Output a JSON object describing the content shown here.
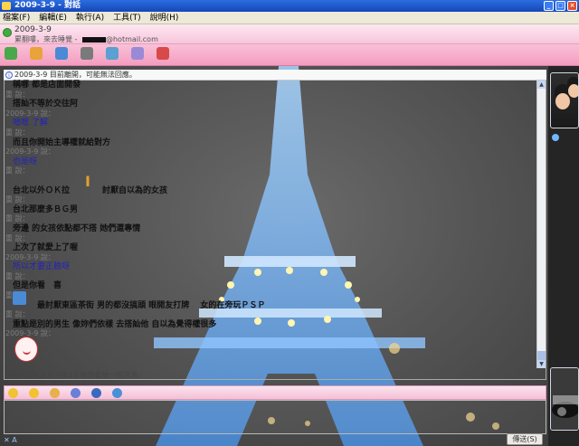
{
  "window": {
    "title": "2009-3-9 - 對話"
  },
  "menu": [
    "檔案(F)",
    "編輯(E)",
    "執行(A)",
    "工具(T)",
    "說明(H)"
  ],
  "contact": {
    "name": "2009-3-9",
    "message": "累翻嘍，來去睡覺 -",
    "email_suffix": "@hotmail.com"
  },
  "notice": "2009-3-9 目前離開，可能無法回應。",
  "messages": [
    {
      "text": "稱哪 都是店面開發",
      "style": "msg"
    },
    {
      "text": "重 說：",
      "style": "sys"
    },
    {
      "text": "搭訕不等於交往阿",
      "style": "msg"
    },
    {
      "text": "2009-3-9 說：",
      "style": "sys"
    },
    {
      "text": "嗯嗯 了解",
      "style": "blue"
    },
    {
      "text": "重 說：",
      "style": "sys"
    },
    {
      "text": "而且你開始主導權就給對方",
      "style": "msg"
    },
    {
      "text": "2009-3-9 說：",
      "style": "sys"
    },
    {
      "text": "也是呀",
      "style": "blue"
    },
    {
      "text": "重 說：",
      "style": "sys"
    },
    {
      "text": "",
      "style": "msg"
    },
    {
      "text": "台北以外ＯＫ拉　　　　討厭自以為的女孩",
      "style": "msg"
    },
    {
      "text": "重 說：",
      "style": "sys"
    },
    {
      "text": "台北那麼多ＢＧ男",
      "style": "msg"
    },
    {
      "text": "重 說：",
      "style": "sys"
    },
    {
      "text": "旁邊 的女孩依點都不搭 她們還專情",
      "style": "msg"
    },
    {
      "text": "重 說：",
      "style": "sys"
    },
    {
      "text": "上次了就愛上了喔",
      "style": "msg"
    },
    {
      "text": "2009-3-9 說：",
      "style": "sys"
    },
    {
      "text": "所以才要正臉呀",
      "style": "blue"
    },
    {
      "text": "重 說：",
      "style": "sys"
    },
    {
      "text": "但是你看　喜",
      "style": "msg"
    },
    {
      "text": "重 說：",
      "style": "sys"
    },
    {
      "text": "　　　最討厭東區茶街 男的都沒搞頭 眼開友打牌　 女的在旁玩ＰＳＰ",
      "style": "msg"
    },
    {
      "text": "重 說：",
      "style": "sys"
    },
    {
      "text": "重點是別的男生 像妳們依樣 去搭訕他 自以為覺得權很多",
      "style": "msg"
    },
    {
      "text": "2009-3-9 說：",
      "style": "sys"
    }
  ],
  "status_line": "2009/3/9 上午 04:19 收到最後一則訊息。",
  "send_label": "傳送(S)",
  "bottom_tabs": "✕ A"
}
